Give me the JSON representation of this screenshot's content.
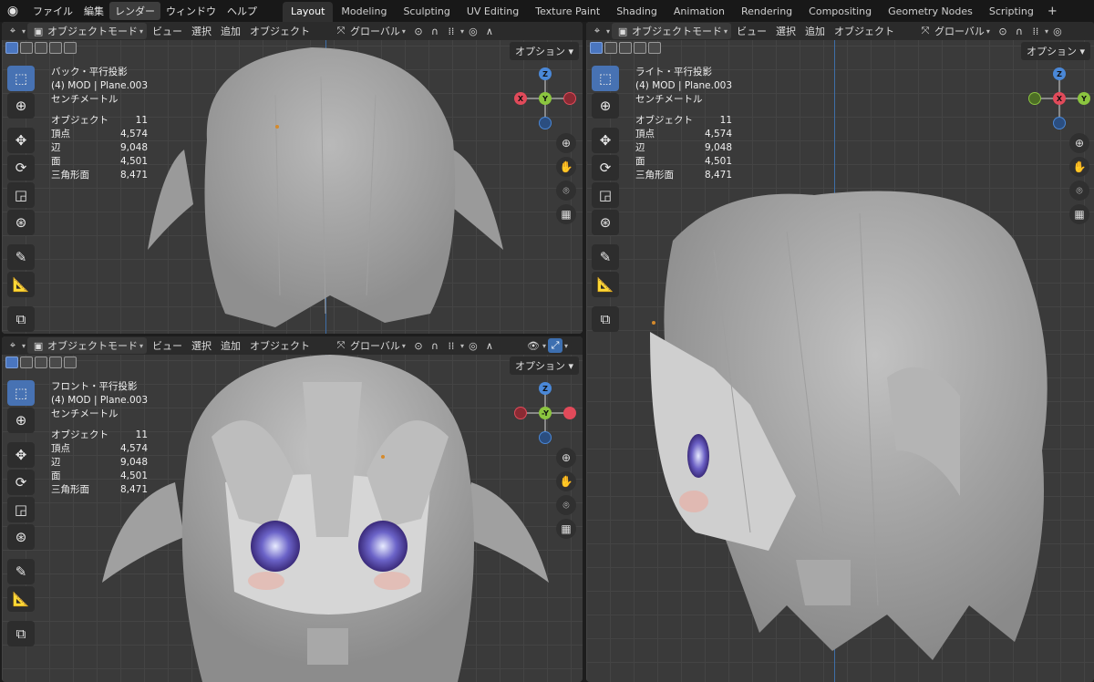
{
  "topbar": {
    "menus": [
      "ファイル",
      "編集",
      "レンダー",
      "ウィンドウ",
      "ヘルプ"
    ],
    "active_menu": "レンダー",
    "workspaces": [
      "Layout",
      "Modeling",
      "Sculpting",
      "UV Editing",
      "Texture Paint",
      "Shading",
      "Animation",
      "Rendering",
      "Compositing",
      "Geometry Nodes",
      "Scripting"
    ],
    "active_workspace": "Layout",
    "add_tab": "+"
  },
  "viewport_header": {
    "mode": "オブジェクトモード",
    "view": "ビュー",
    "select": "選択",
    "add": "追加",
    "object": "オブジェクト",
    "orientation": "グローバル",
    "options": "オプション"
  },
  "viewports": {
    "back": {
      "projection": "バック・平行投影",
      "object_line": "(4) MOD | Plane.003",
      "units": "センチメートル"
    },
    "front": {
      "projection": "フロント・平行投影",
      "object_line": "(4) MOD | Plane.003",
      "units": "センチメートル"
    },
    "right": {
      "projection": "ライト・平行投影",
      "object_line": "(4) MOD | Plane.003",
      "units": "センチメートル"
    }
  },
  "stats": {
    "objects_label": "オブジェクト",
    "objects": "11",
    "verts_label": "頂点",
    "verts": "4,574",
    "edges_label": "辺",
    "edges": "9,048",
    "faces_label": "面",
    "faces": "4,501",
    "tris_label": "三角形面",
    "tris": "8,471"
  },
  "gizmo": {
    "x": "X",
    "y": "Y",
    "z": "Z",
    "neg_y": "-Y"
  },
  "colors": {
    "x_axis": "#e14a5a",
    "y_axis": "#8bc53f",
    "z_axis": "#4a88d8",
    "accent": "#4772b3",
    "grid": "#3a3a3a"
  },
  "icons": [
    "select-box-icon",
    "cursor-icon",
    "move-icon",
    "rotate-icon",
    "scale-icon",
    "transform-icon",
    "annotate-icon",
    "measure-icon",
    "add-cube-icon",
    "zoom-icon",
    "hand-icon",
    "camera-icon",
    "grid-icon"
  ]
}
